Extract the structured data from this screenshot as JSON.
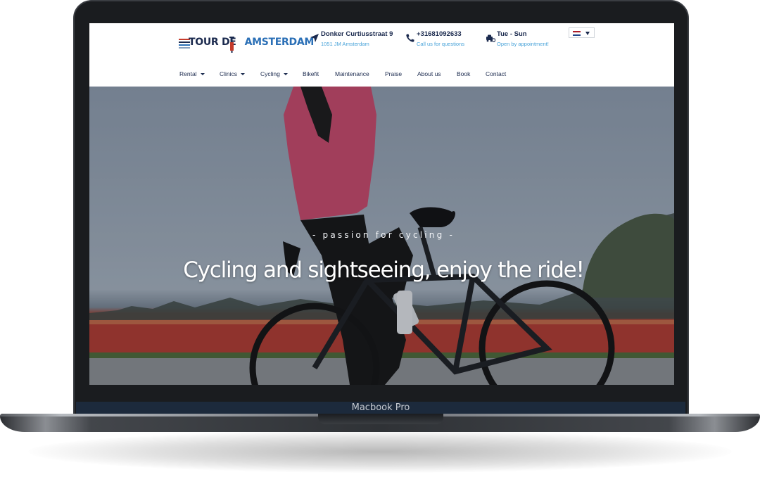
{
  "device": {
    "label": "Macbook Pro"
  },
  "site": {
    "logo": {
      "text_dark": "TOUR DE",
      "text_blue": "AMSTERDAM"
    },
    "address": {
      "title": "Donker Curtiusstraat 9",
      "subtitle": "1051 JM Amsterdam",
      "icon": "location-arrow-icon"
    },
    "phone": {
      "title": "+31681092633",
      "subtitle": "Call us for questions",
      "icon": "phone-icon"
    },
    "hours": {
      "title": "Tue - Sun",
      "subtitle": "Open by appointment!",
      "icon": "bike-car-icon"
    },
    "language": {
      "flag": "netherlands-flag",
      "colors": [
        "#ae1c28",
        "#ffffff",
        "#21468b"
      ]
    },
    "nav": [
      {
        "label": "Rental",
        "dropdown": true
      },
      {
        "label": "Clinics",
        "dropdown": true
      },
      {
        "label": "Cycling",
        "dropdown": true
      },
      {
        "label": "Bikefit",
        "dropdown": false
      },
      {
        "label": "Maintenance",
        "dropdown": false
      },
      {
        "label": "Praise",
        "dropdown": false
      },
      {
        "label": "About us",
        "dropdown": false
      },
      {
        "label": "Book",
        "dropdown": false
      },
      {
        "label": "Contact",
        "dropdown": false
      }
    ],
    "hero": {
      "kicker": "- passion for cycling -",
      "title": "Cycling and sightseeing, enjoy the ride!"
    }
  },
  "colors": {
    "navy": "#1b2a4e",
    "accent_blue": "#49a3d9",
    "jersey_pink": "#d0466e"
  }
}
